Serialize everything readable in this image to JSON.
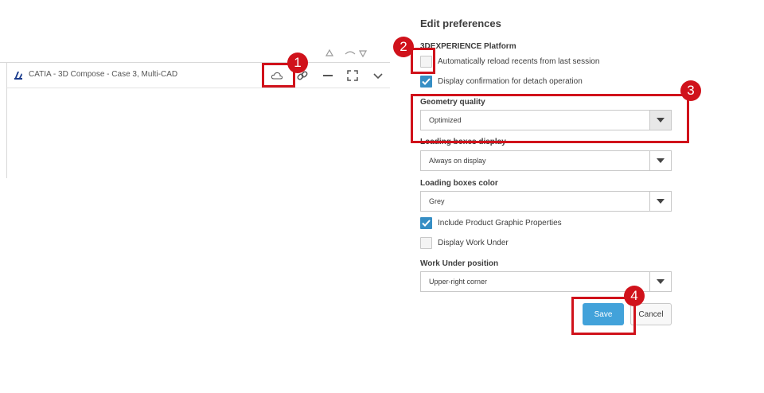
{
  "widget": {
    "title": "CATIA - 3D Compose - Case 3, Multi-CAD",
    "toolbar_icons": [
      "cloud-icon",
      "link-icon",
      "minimize-icon",
      "maximize-icon",
      "chevron-down-icon"
    ]
  },
  "preferences": {
    "title": "Edit preferences",
    "platform_section": "3DEXPERIENCE Platform",
    "auto_reload": {
      "label": "Automatically reload recents from last session",
      "checked": false
    },
    "detach_confirm": {
      "label": "Display confirmation for detach operation",
      "checked": true
    },
    "geometry_quality": {
      "label": "Geometry quality",
      "value": "Optimized"
    },
    "loading_boxes_display": {
      "label": "Loading boxes display",
      "value": "Always on display"
    },
    "loading_boxes_color": {
      "label": "Loading boxes color",
      "value": "Grey"
    },
    "include_graphic_props": {
      "label": "Include Product Graphic Properties",
      "checked": true
    },
    "display_work_under": {
      "label": "Display Work Under",
      "checked": false
    },
    "work_under_position": {
      "label": "Work Under position",
      "value": "Upper-right corner"
    },
    "save_label": "Save",
    "cancel_label": "Cancel"
  },
  "annotations": {
    "step1": "1",
    "step2": "2",
    "step3": "3",
    "step4": "4"
  },
  "colors": {
    "accent": "#42a2da",
    "checkbox_checked": "#368ec4",
    "annotation_red": "#d0121b"
  }
}
